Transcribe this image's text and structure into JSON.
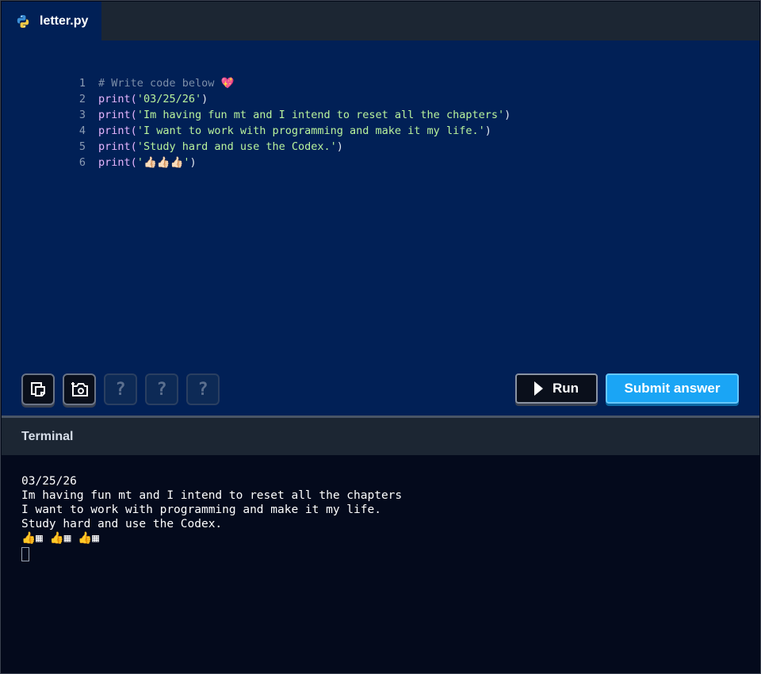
{
  "tab": {
    "filename": "letter.py",
    "icon": "python-logo-icon"
  },
  "editor": {
    "lines": [
      {
        "num": "1",
        "comment": "# Write code below 💖"
      },
      {
        "num": "2",
        "fn": "print(",
        "str": "'03/25/26'",
        "close": ")"
      },
      {
        "num": "3",
        "fn": "print(",
        "str": "'Im having fun mt and I intend to reset all the chapters'",
        "close": ")"
      },
      {
        "num": "4",
        "fn": "print(",
        "str": "'I want to work with programming and make it my life.'",
        "close": ")"
      },
      {
        "num": "5",
        "fn": "print(",
        "str": "'Study hard and use the Codex.'",
        "close": ")"
      },
      {
        "num": "6",
        "fn": "print(",
        "str": "'👍🏻👍🏻👍🏻'",
        "close": ")"
      }
    ]
  },
  "toolbar": {
    "help_label": "?",
    "run_label": "Run",
    "submit_label": "Submit answer"
  },
  "terminal": {
    "title": "Terminal",
    "output": [
      "03/25/26",
      "Im having fun mt and I intend to reset all the chapters",
      "I want to work with programming and make it my life.",
      "Study hard and use the Codex.",
      "👍▦ 👍▦ 👍▦"
    ]
  },
  "colors": {
    "editor_bg": "#012056",
    "terminal_bg": "#040a1c",
    "submit_bg": "#1aa5f5",
    "keyword": "#e8b6ff",
    "string": "#b9f29c"
  }
}
